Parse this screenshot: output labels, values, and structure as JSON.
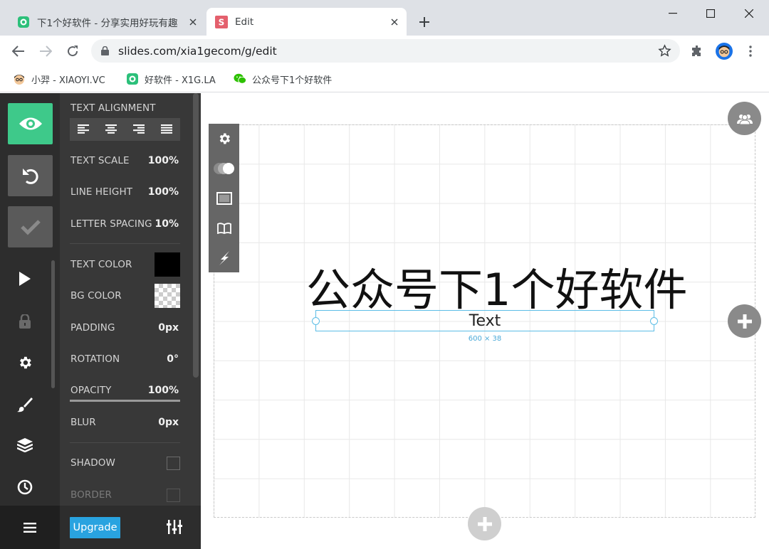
{
  "tabs": [
    {
      "title": "下1个好软件 - 分享实用好玩有趣",
      "favicon": "x1g-icon"
    },
    {
      "title": "Edit",
      "favicon": "slides-icon",
      "active": true
    }
  ],
  "address_bar": {
    "url": "slides.com/xia1gecom/g/edit"
  },
  "bookmarks": [
    {
      "label": "小羿 - XIAOYI.VC",
      "icon": "avatar-icon"
    },
    {
      "label": "好软件 - X1G.LA",
      "icon": "x1g-icon"
    },
    {
      "label": "公众号下1个好软件",
      "icon": "wechat-icon"
    }
  ],
  "panel": {
    "text_alignment_label": "TEXT ALIGNMENT",
    "text_scale_label": "TEXT SCALE",
    "text_scale_value": "100%",
    "line_height_label": "LINE HEIGHT",
    "line_height_value": "100%",
    "letter_spacing_label": "LETTER SPACING",
    "letter_spacing_value": "10%",
    "text_color_label": "TEXT COLOR",
    "text_color": "#000000",
    "bg_color_label": "BG COLOR",
    "padding_label": "PADDING",
    "padding_value": "0px",
    "rotation_label": "ROTATION",
    "rotation_value": "0°",
    "opacity_label": "OPACITY",
    "opacity_value": "100%",
    "blur_label": "BLUR",
    "blur_value": "0px",
    "shadow_label": "SHADOW",
    "border_label": "BORDER",
    "upgrade_label": "Upgrade"
  },
  "canvas": {
    "heading": "公众号下1个好软件",
    "selected_text": "Text",
    "dimensions": "600 × 38"
  },
  "colors": {
    "accent_green": "#3ec98a",
    "accent_blue": "#29a3e0",
    "selection": "#5cbde6"
  }
}
